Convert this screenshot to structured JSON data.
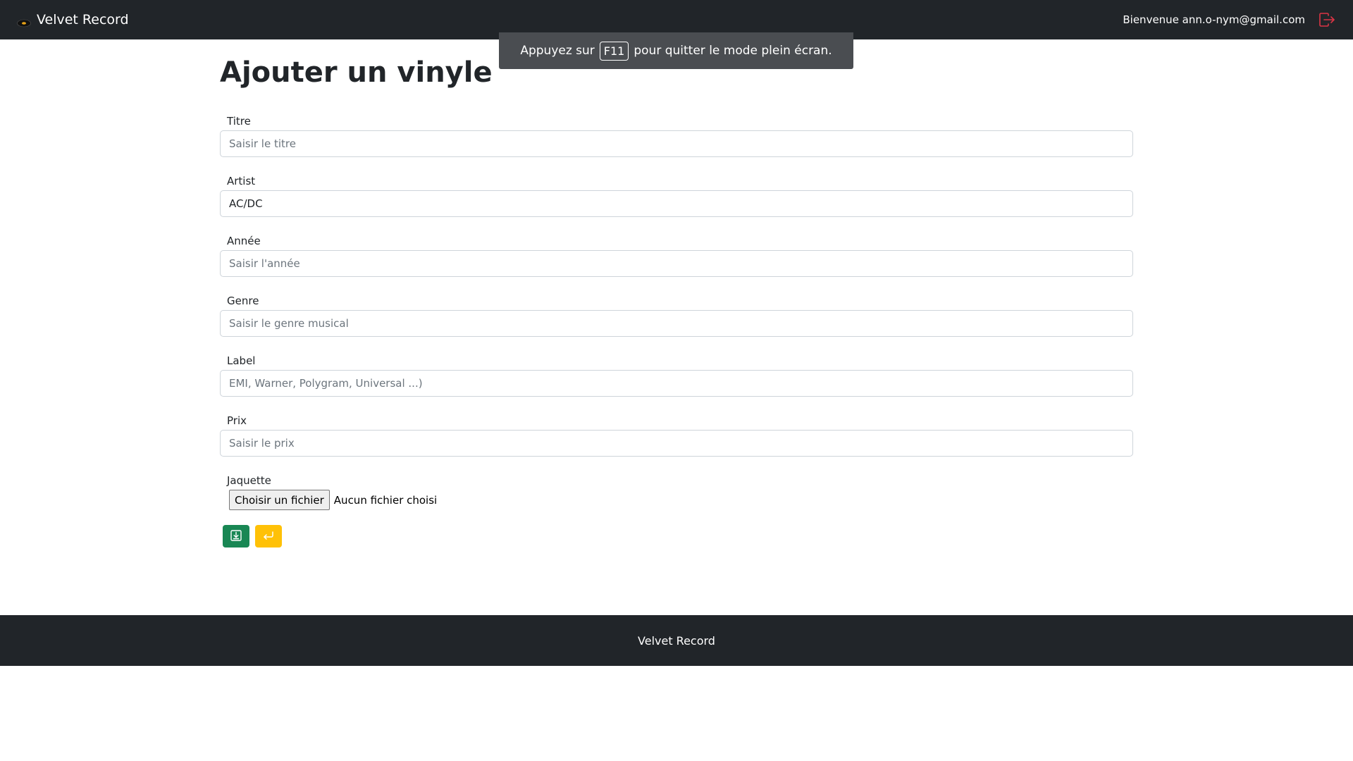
{
  "navbar": {
    "brand": "Velvet Record",
    "welcome": "Bienvenue ann.o-nym@gmail.com",
    "logout_icon": "logout-icon",
    "logout_color": "#dc3545"
  },
  "fullscreen_notice": {
    "before": "Appuyez sur",
    "key": "F11",
    "after": "pour quitter le mode plein écran."
  },
  "page": {
    "title": "Ajouter un vinyle"
  },
  "form": {
    "titre": {
      "label": "Titre",
      "value": "",
      "placeholder": "Saisir le titre"
    },
    "artist": {
      "label": "Artist",
      "value": "AC/DC",
      "placeholder": ""
    },
    "annee": {
      "label": "Année",
      "value": "",
      "placeholder": "Saisir l'année"
    },
    "genre": {
      "label": "Genre",
      "value": "",
      "placeholder": "Saisir le genre musical"
    },
    "label": {
      "label": "Label",
      "value": "",
      "placeholder": "EMI, Warner, Polygram, Universal ...)"
    },
    "prix": {
      "label": "Prix",
      "value": "",
      "placeholder": "Saisir le prix"
    },
    "jaquette": {
      "label": "Jaquette",
      "button": "Choisir un fichier",
      "status": "Aucun fichier choisi"
    }
  },
  "actions": {
    "save_icon": "save-icon",
    "save_color": "#198754",
    "back_icon": "return-icon",
    "back_color": "#ffc107"
  },
  "footer": {
    "text": "Velvet Record"
  }
}
